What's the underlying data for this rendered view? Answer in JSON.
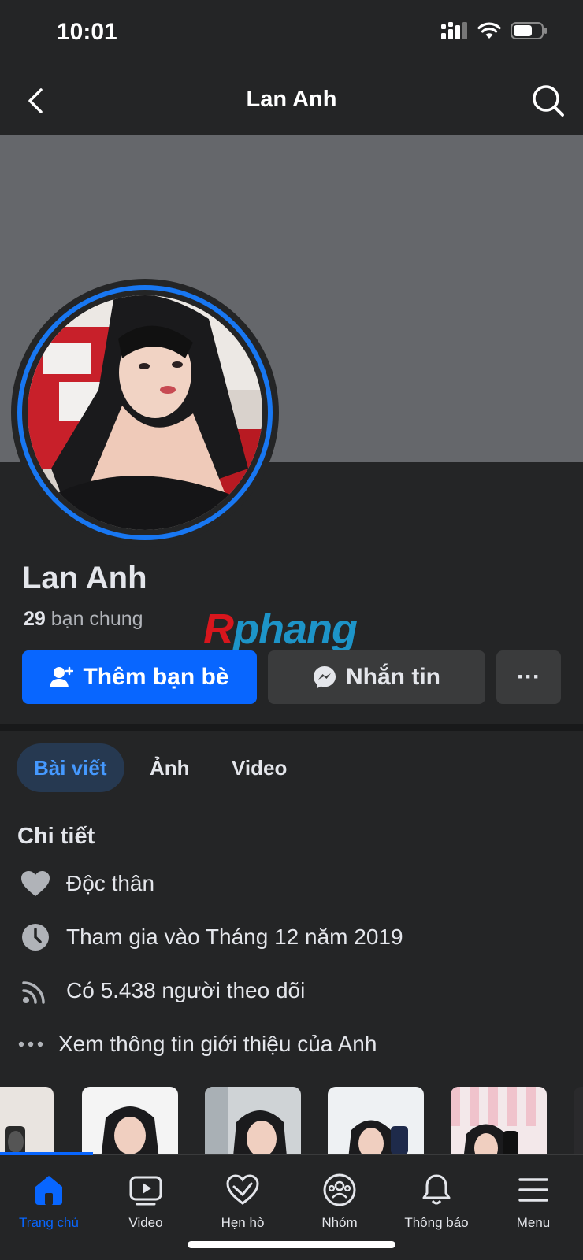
{
  "status_bar": {
    "time": "10:01"
  },
  "header": {
    "title": "Lan Anh"
  },
  "profile": {
    "name": "Lan Anh",
    "mutual_count": "29",
    "mutual_label": "bạn chung"
  },
  "watermark": {
    "first": "R",
    "rest": "phang"
  },
  "actions": {
    "add_friend": "Thêm bạn bè",
    "message": "Nhắn tin",
    "more": "···"
  },
  "tabs": [
    {
      "label": "Bài viết",
      "active": true
    },
    {
      "label": "Ảnh",
      "active": false
    },
    {
      "label": "Video",
      "active": false
    }
  ],
  "details": {
    "title": "Chi tiết",
    "items": [
      {
        "icon": "heart-icon",
        "text": "Độc thân"
      },
      {
        "icon": "clock-icon",
        "text": "Tham gia vào Tháng 12 năm 2019"
      },
      {
        "icon": "rss-icon",
        "text": "Có 5.438 người theo dõi"
      },
      {
        "icon": "dots-icon",
        "text": "Xem thông tin giới thiệu của Anh"
      }
    ]
  },
  "bottom_nav": [
    {
      "label": "Trang chủ",
      "icon": "home-icon",
      "active": true
    },
    {
      "label": "Video",
      "icon": "video-icon",
      "active": false
    },
    {
      "label": "Hẹn hò",
      "icon": "dating-heart-icon",
      "active": false
    },
    {
      "label": "Nhóm",
      "icon": "groups-icon",
      "active": false
    },
    {
      "label": "Thông báo",
      "icon": "bell-icon",
      "active": false
    },
    {
      "label": "Menu",
      "icon": "menu-icon",
      "active": false
    }
  ],
  "colors": {
    "accent": "#0866ff",
    "background": "#242526",
    "cover": "#65676b",
    "tab_active_bg": "#263951",
    "tab_active_text": "#4599ff"
  }
}
